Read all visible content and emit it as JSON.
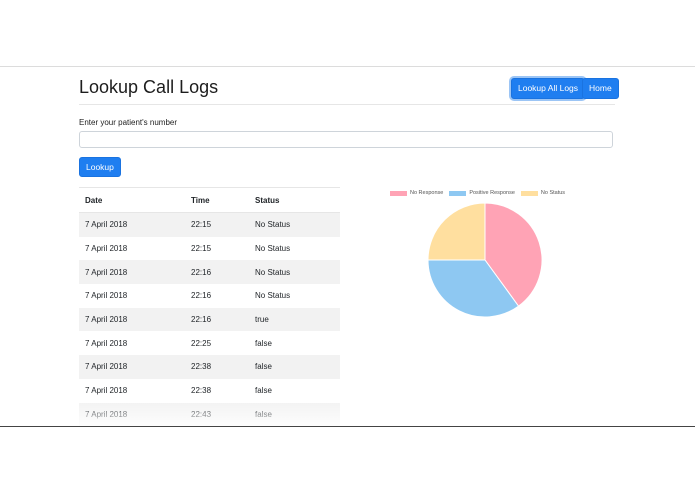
{
  "header": {
    "title": "Lookup Call Logs",
    "lookup_all_label": "Lookup All Logs",
    "home_label": "Home"
  },
  "search": {
    "label": "Enter your patient's number",
    "value": "",
    "button_label": "Lookup"
  },
  "table": {
    "columns": [
      "Date",
      "Time",
      "Status"
    ],
    "rows": [
      {
        "date": "7 April 2018",
        "time": "22:15",
        "status": "No Status"
      },
      {
        "date": "7 April 2018",
        "time": "22:15",
        "status": "No Status"
      },
      {
        "date": "7 April 2018",
        "time": "22:16",
        "status": "No Status"
      },
      {
        "date": "7 April 2018",
        "time": "22:16",
        "status": "No Status"
      },
      {
        "date": "7 April 2018",
        "time": "22:16",
        "status": "true"
      },
      {
        "date": "7 April 2018",
        "time": "22:25",
        "status": "false"
      },
      {
        "date": "7 April 2018",
        "time": "22:38",
        "status": "false"
      },
      {
        "date": "7 April 2018",
        "time": "22:38",
        "status": "false"
      },
      {
        "date": "7 April 2018",
        "time": "22:43",
        "status": "false"
      }
    ]
  },
  "chart_data": {
    "type": "pie",
    "labels": [
      "No Response",
      "Positive Response",
      "No Status"
    ],
    "values": [
      40,
      35,
      25
    ],
    "colors": [
      "#ffa3b5",
      "#8ec8f2",
      "#ffdf9f"
    ],
    "legend_position": "top"
  },
  "colors": {
    "primary": "#1f7ef0",
    "stripe": "#f2f2f2"
  }
}
